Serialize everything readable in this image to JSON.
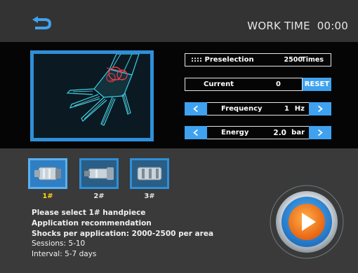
{
  "header": {
    "back_icon": "back-arrow-icon",
    "work_time_label": "WORK TIME",
    "work_time_value": "00:00"
  },
  "params": {
    "preselection": {
      "icon": "dots-icon",
      "prefix": "::::",
      "label": "Preselection",
      "value": "2500",
      "unit": "Times"
    },
    "current": {
      "label": "Current",
      "value": "0",
      "reset_label": "RESET"
    },
    "frequency": {
      "label": "Frequency",
      "value": "1",
      "unit": "Hz"
    },
    "energy": {
      "label": "Energy",
      "value": "2.0",
      "unit": "bar"
    }
  },
  "handpieces": [
    {
      "label": "1#",
      "selected": true
    },
    {
      "label": "2#",
      "selected": false
    },
    {
      "label": "3#",
      "selected": false
    }
  ],
  "info": {
    "select_text": "Please select 1# handpiece",
    "recommendation_title": "Application recommendation",
    "shocks": "Shocks per application:  2000-2500 per area",
    "sessions": "Sessions:  5-10",
    "interval": "Interval:  5-7 days"
  },
  "colors": {
    "accent": "#3fa2f0",
    "frame": "#2f8fd8",
    "selected_label": "#ffd21a",
    "play": "#f07a1a"
  }
}
